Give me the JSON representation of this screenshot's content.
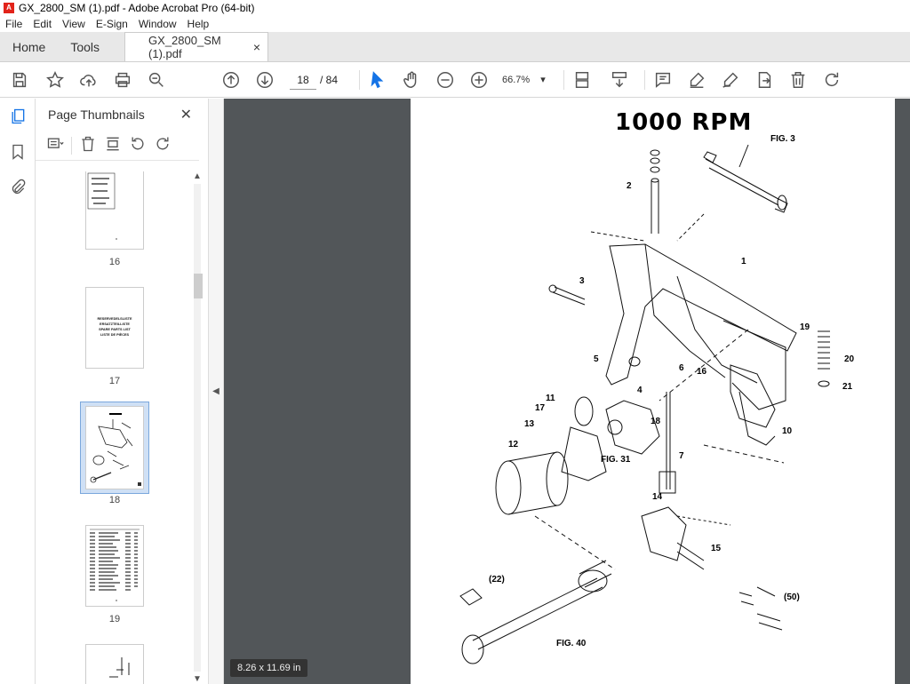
{
  "window": {
    "title": "GX_2800_SM (1).pdf - Adobe Acrobat Pro (64-bit)",
    "logo_text": "A"
  },
  "menu": [
    "File",
    "Edit",
    "View",
    "E-Sign",
    "Window",
    "Help"
  ],
  "tabs": {
    "home": "Home",
    "tools": "Tools",
    "document": "GX_2800_SM (1).pdf",
    "close": "×"
  },
  "toolbar": {
    "page_current": "18",
    "page_total": "/ 84",
    "zoom": "66.7%"
  },
  "thumbnails": {
    "title": "Page Thumbnails",
    "close": "✕",
    "pages": [
      {
        "label": "16"
      },
      {
        "label": "17",
        "lines": [
          "RESERVEDELSLISTE",
          "ERSATZTEILLISTE",
          "SPARE PARTS LIST",
          "LISTE DE PIÈCES"
        ]
      },
      {
        "label": "18",
        "selected": true
      },
      {
        "label": "19"
      },
      {
        "label": ""
      }
    ]
  },
  "document": {
    "heading": "1000 RPM",
    "page_size": "8.26 x 11.69 in",
    "callouts": [
      "FIG. 3",
      "1",
      "2",
      "3",
      "4",
      "5",
      "6",
      "7",
      "10",
      "11",
      "12",
      "13",
      "14",
      "15",
      "16",
      "17",
      "18",
      "19",
      "20",
      "21",
      "(22)",
      "(50)",
      "FIG. 31",
      "FIG. 40"
    ]
  }
}
